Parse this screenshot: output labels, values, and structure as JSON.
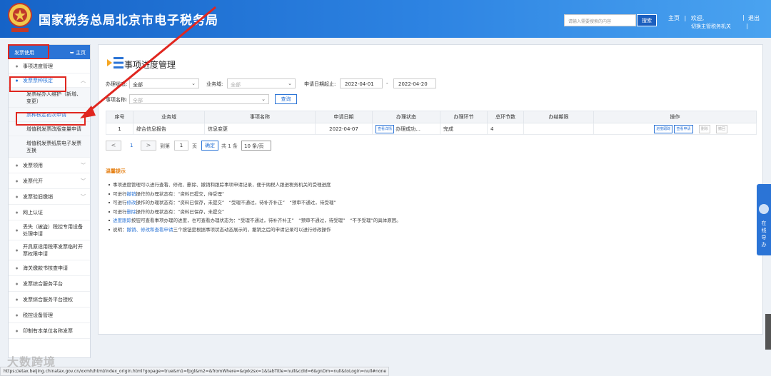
{
  "header": {
    "site_title": "国家税务总局北京市电子税务局",
    "emblem_text": "税",
    "search_placeholder": "请输入需要搜索的内容",
    "search_button": "搜索",
    "home_link": "主页",
    "welcome": "欢迎,",
    "switch_org": "切换主管税务机关",
    "logout": "退出"
  },
  "sidebar": {
    "section_title": "发票使用",
    "home_label": "主页",
    "items": [
      {
        "label": "事项进度管理"
      },
      {
        "label": "发票票种核定"
      },
      {
        "label": "发票经办人维护（新增、变更）"
      },
      {
        "label": "票种核定初次申请"
      },
      {
        "label": "增值税发票改版变量申请"
      },
      {
        "label": "增值税发票纸质电子发票互换"
      },
      {
        "label": "发票领用"
      },
      {
        "label": "发票代开"
      },
      {
        "label": "发票验旧缴销"
      },
      {
        "label": "网上认证"
      },
      {
        "label": "丢失（被盗）税控专用设备处理申请"
      },
      {
        "label": "开具原适用税率发票临时开票权限申请"
      },
      {
        "label": "海关缴款书核查申请"
      },
      {
        "label": "发票综合服务平台"
      },
      {
        "label": "发票综合服务平台授权"
      },
      {
        "label": "税控设备管理"
      },
      {
        "label": "印制有本单位名称发票"
      }
    ]
  },
  "main": {
    "title": "事项进度管理",
    "filters": {
      "status_label": "办理状态:",
      "status_value": "全部",
      "domain_label": "业务域:",
      "domain_value": "全部",
      "date_label": "申请日期起止:",
      "date_from": "2022-04-01",
      "date_sep": "-",
      "date_to": "2022-04-20",
      "item_label": "事项名称:",
      "item_value": "全部",
      "query_button": "查询"
    },
    "table": {
      "headers": [
        "序号",
        "业务域",
        "事项名称",
        "申请日期",
        "办理状态",
        "办理环节",
        "总环节数",
        "办结期限",
        "操作"
      ],
      "rows": [
        {
          "index": "1",
          "domain": "综合信息报告",
          "item": "信息变更",
          "date": "2022-04-07",
          "view_detail": "查看详情",
          "status": "办理成功...",
          "step": "完成",
          "total": "4",
          "deadline": "",
          "actions": [
            "进度跟踪",
            "查看申请",
            "删除",
            "撤回"
          ]
        }
      ]
    },
    "pager": {
      "prev": "<",
      "current_page": "1",
      "next": ">",
      "goto_label": "到第",
      "goto_value": "1",
      "page_unit": "页",
      "confirm": "确定",
      "total": "共 1 条",
      "page_size": "10 条/页"
    },
    "tips": {
      "title": "温馨提示",
      "lines": [
        {
          "parts": [
            "事项进度管理可以进行查看、修改、删除、撤销和跟踪事项申请记录，便于纳税人跟进税务机关的受理进度"
          ]
        },
        {
          "pre": "可进行",
          "hl": "撤销",
          "post": "操作的办理状态有：“资料已提交，待受理”"
        },
        {
          "pre": "可进行",
          "hl": "修改",
          "post": "操作的办理状态有：“资料已保存，未提交”　“受理不通过，待补齐补正”　“预审不通过，待受理”"
        },
        {
          "pre": "可进行",
          "hl": "删除",
          "post": "操作的办理状态有：“资料已保存，未提交”"
        },
        {
          "pre": "",
          "hl": "进度跟踪",
          "post": "按钮可查看事项办理的进度，也可查看办理状态为：“受理不通过，待补齐补正”　“预审不通过，待受理”　“不予受理”的具体原因。"
        },
        {
          "pre": "说明：",
          "hl": "撤销、修改和查看申请",
          "post": "三个按钮是根据事项状态动态展示的，撤销之后的申请记录可以进行修改操作"
        }
      ]
    }
  },
  "float_guide": {
    "label": "在线导办"
  },
  "status_url": "https://etax.beijing.chinatax.gov.cn/xxmh/html/index_origin.html?gopage=true&m1=fpgl&m2=&fromWhere=&qxkzsx=1&tabTitle=null&cdId=6&gnDm=null&toLogin=null#none",
  "watermark": "大数跨境",
  "colors": {
    "header_blue": "#1663c7",
    "accent": "#2b74d6",
    "annotation_red": "#e0261f",
    "tip_orange": "#e57f12"
  }
}
